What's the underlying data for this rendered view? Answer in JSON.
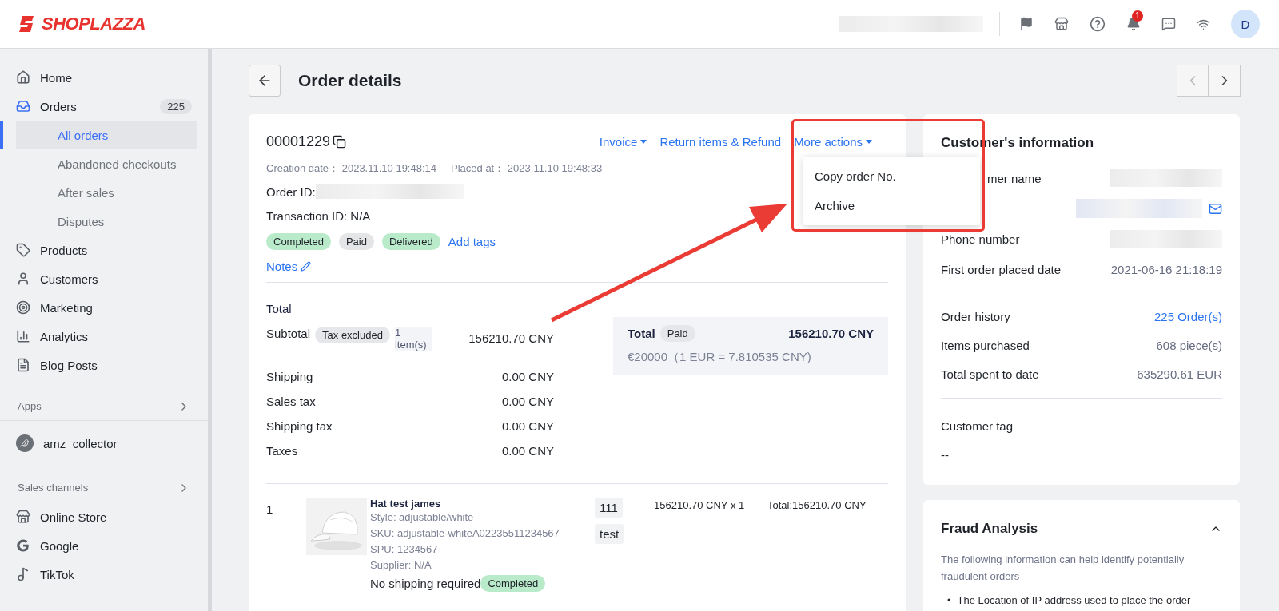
{
  "header": {
    "logo": "SHOPLAZZA",
    "notification_count": "1",
    "avatar": "D"
  },
  "sidebar": {
    "items": [
      {
        "kind": "item",
        "label": "Home",
        "selected": false
      },
      {
        "kind": "item",
        "label": "Orders",
        "badge": "225",
        "selected": true,
        "children": [
          {
            "kind": "sub",
            "label": "All orders",
            "selected": true
          },
          {
            "kind": "sub",
            "label": "Abandoned checkouts",
            "selected": false
          },
          {
            "kind": "sub",
            "label": "After sales",
            "selected": false
          },
          {
            "kind": "sub",
            "label": "Disputes",
            "selected": false
          }
        ]
      },
      {
        "kind": "item",
        "label": "Products",
        "selected": false
      },
      {
        "kind": "item",
        "label": "Customers",
        "selected": false
      },
      {
        "kind": "item",
        "label": "Marketing",
        "selected": false
      },
      {
        "kind": "item",
        "label": "Analytics",
        "selected": false
      },
      {
        "kind": "item",
        "label": "Blog Posts",
        "selected": false
      },
      {
        "kind": "section",
        "label": "Apps"
      },
      {
        "kind": "app",
        "label": "amz_collector",
        "selected": false
      },
      {
        "kind": "section",
        "label": "Sales channels"
      },
      {
        "kind": "item",
        "label": "Online Store",
        "selected": false
      },
      {
        "kind": "item",
        "label": "Google",
        "selected": false
      },
      {
        "kind": "item",
        "label": "TikTok",
        "selected": false
      }
    ]
  },
  "page": {
    "title": "Order details"
  },
  "order": {
    "number": "00001229",
    "actions": [
      {
        "label": "Invoice",
        "dropdown": true
      },
      {
        "label": "Return items & Refund",
        "dropdown": false
      },
      {
        "label": "More actions",
        "dropdown": true
      }
    ],
    "menu": [
      "Copy order No.",
      "Archive"
    ],
    "meta": [
      {
        "label": "Creation date：",
        "value": "2023.11.10 19:48:14"
      },
      {
        "label": "Placed at：",
        "value": "2023.11.10 19:48:33"
      }
    ],
    "order_id_label": "Order ID:",
    "transaction": "Transaction ID: N/A",
    "tags": [
      {
        "label": "Completed",
        "color": "#b9ebcb"
      },
      {
        "label": "Paid",
        "color": "#e4e5e7"
      },
      {
        "label": "Delivered",
        "color": "#b9ebcb"
      }
    ],
    "add_tags": "Add tags",
    "notes": "Notes"
  },
  "totals": {
    "title": "Total",
    "rows": [
      {
        "label": "Subtotal",
        "badge": "Tax excluded",
        "note": "1 item(s)",
        "value": "156210.70 CNY"
      },
      {
        "label": "Shipping",
        "value": "0.00 CNY"
      },
      {
        "label": "Sales tax",
        "value": "0.00 CNY"
      },
      {
        "label": "Shipping tax",
        "value": "0.00 CNY"
      },
      {
        "label": "Taxes",
        "value": "0.00 CNY"
      }
    ]
  },
  "summary": {
    "label": "Total",
    "badge": "Paid",
    "value": "156210.70 CNY",
    "converted": "€20000（1 EUR = 7.810535 CNY)"
  },
  "line_items": [
    {
      "index": "1",
      "name": "Hat test james",
      "details": [
        "Style: adjustable/white",
        "SKU: adjustable-whiteA02235511234567",
        "SPU: 1234567",
        "Supplier: N/A"
      ],
      "tags": [
        "111",
        "test"
      ],
      "price": "156210.70 CNY x 1",
      "total": "Total:156210.70 CNY",
      "shipping": "No shipping required",
      "status": "Completed"
    }
  ],
  "customer": {
    "title": "Customer's information",
    "rows": [
      {
        "kind": "blurred",
        "label": "mer name"
      },
      {
        "kind": "email"
      },
      {
        "kind": "blurred",
        "label": "Phone number"
      },
      {
        "kind": "value",
        "label": "First order placed date",
        "value": "2021-06-16 21:18:19"
      }
    ],
    "stats": [
      {
        "label": "Order history",
        "value": "225 Order(s)",
        "link": true
      },
      {
        "label": "Items purchased",
        "value": "608 piece(s)",
        "link": false
      },
      {
        "label": "Total spent to date",
        "value": "635290.61 EUR",
        "link": false
      }
    ],
    "tag_label": "Customer tag",
    "tag_value": "--"
  },
  "fraud": {
    "title": "Fraud Analysis",
    "expanded": true,
    "intro": "The following information can help identify potentially fraudulent orders",
    "bullets": [
      {
        "marker": "•",
        "text": "The Location of IP address used to place the order"
      }
    ]
  }
}
